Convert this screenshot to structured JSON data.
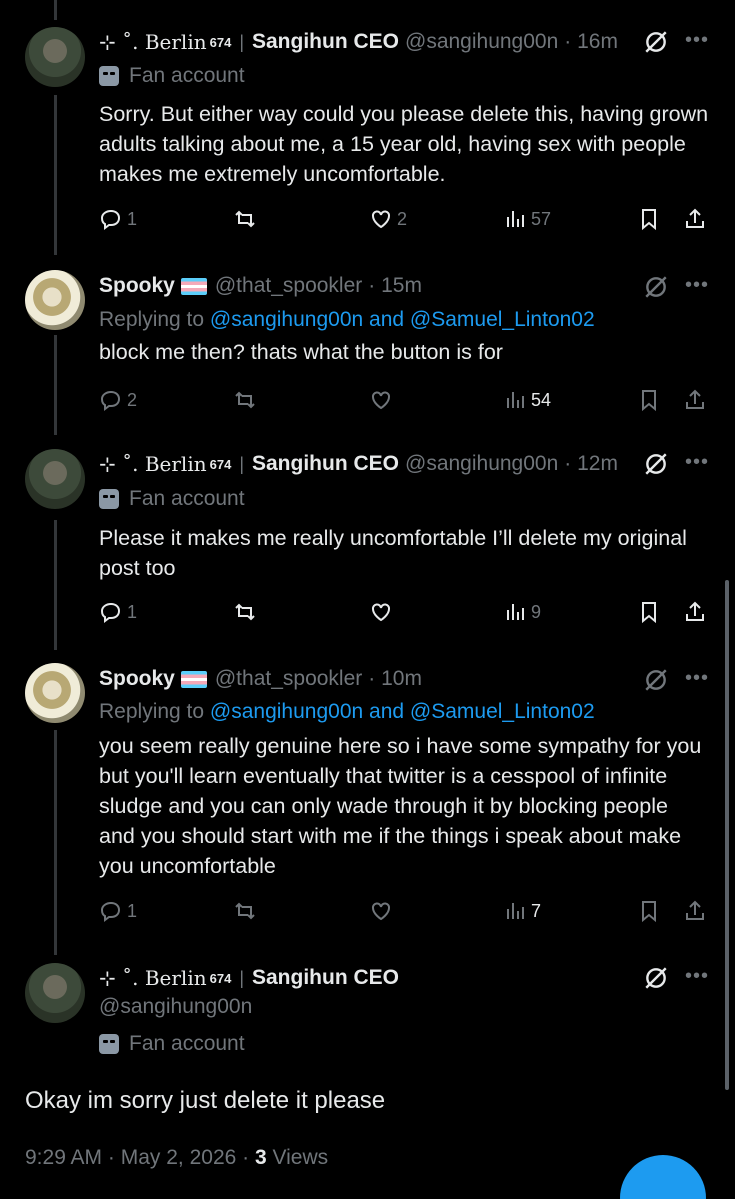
{
  "posts": [
    {
      "name_decor": "⊹ ˚. Berlin",
      "name_sup": "674",
      "name_sep": "|",
      "name2": "Sangihun CEO",
      "handle": "@sangihung00n",
      "time": "· 16m",
      "badge": "Fan account",
      "text": "Sorry. But either way could you please delete this, having grown adults talking about me, a 15 year old, having sex with people makes me extremely uncomfortable.",
      "replies": "1",
      "retweets": "",
      "likes": "2",
      "views": "57"
    },
    {
      "name": "Spooky",
      "handle": "@that_spookler",
      "time": "· 15m",
      "replying_label": "Replying to",
      "replying_to": "@sangihung00n and @Samuel_Linton02",
      "text": "block me then? thats what the button is for",
      "replies": "2",
      "retweets": "",
      "likes": "",
      "views": "54"
    },
    {
      "name_decor": "⊹ ˚. Berlin",
      "name_sup": "674",
      "name_sep": "|",
      "name2": "Sangihun CEO",
      "handle": "@sangihung00n",
      "time": "· 12m",
      "badge": "Fan account",
      "text": "Please it makes me really uncomfortable I’ll delete my original post too",
      "replies": "1",
      "retweets": "",
      "likes": "",
      "views": "9"
    },
    {
      "name": "Spooky",
      "handle": "@that_spookler",
      "time": "· 10m",
      "replying_label": "Replying to",
      "replying_to": "@sangihung00n and @Samuel_Linton02",
      "text": "you seem really genuine here so i have some sympathy for you but you'll learn eventually that twitter is a cesspool of infinite sludge and you can only wade through it by blocking people and you should start with me if the things i speak about make you uncomfortable",
      "replies": "1",
      "retweets": "",
      "likes": "",
      "views": "7"
    }
  ],
  "main_post": {
    "name_decor": "⊹ ˚. Berlin",
    "name_sup": "674",
    "name_sep": "|",
    "name2": "Sangihun CEO",
    "handle": "@sangihung00n",
    "badge": "Fan account",
    "text": "Okay im sorry just delete it please",
    "time": "9:29 AM",
    "date": "May 2, 2026",
    "views_count": "3",
    "views_label": "Views"
  },
  "icons": {
    "reply": "reply-icon",
    "retweet": "retweet-icon",
    "like": "heart-icon",
    "views": "views-icon",
    "bookmark": "bookmark-icon",
    "share": "share-icon",
    "grok": "grok-icon",
    "more": "more-icon"
  },
  "colors": {
    "background": "#000000",
    "text": "#e7e9ea",
    "muted": "#71767b",
    "link": "#1d9bf0"
  }
}
